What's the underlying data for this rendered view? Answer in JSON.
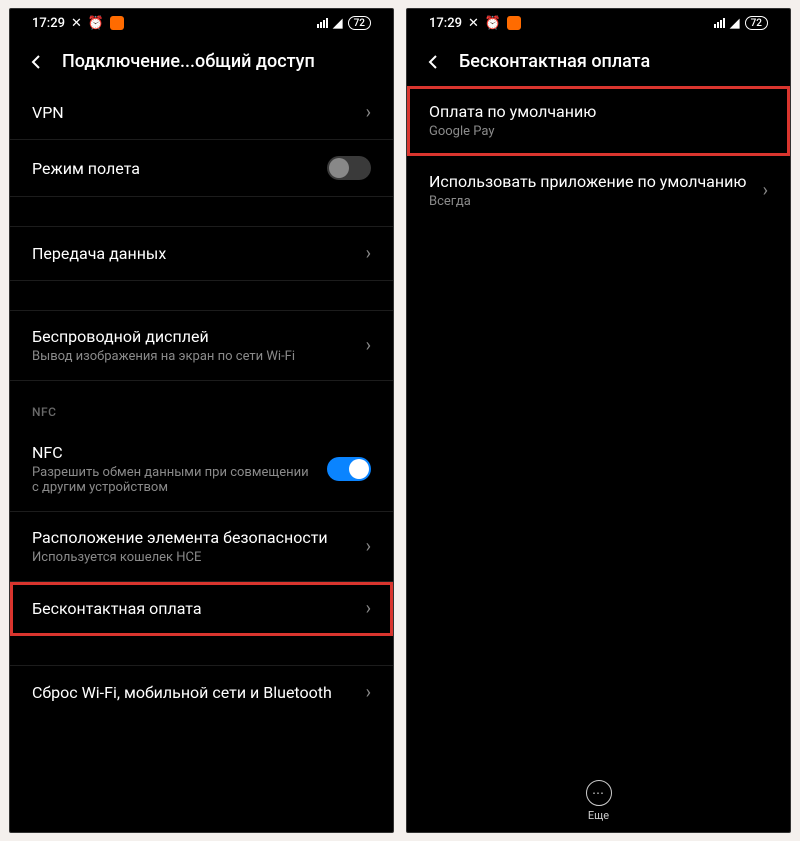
{
  "status": {
    "time": "17:29",
    "battery": "72"
  },
  "left": {
    "title": "Подключение...общий доступ",
    "items": {
      "vpn": "VPN",
      "airplane": "Режим полета",
      "data": "Передача данных",
      "wireless_display": {
        "title": "Беспроводной дисплей",
        "sub": "Вывод изображения на экран по сети Wi-Fi"
      },
      "nfc_section": "NFC",
      "nfc": {
        "title": "NFC",
        "sub": "Разрешить обмен данными при совмещении с другим устройством"
      },
      "secure_element": {
        "title": "Расположение элемента безопасности",
        "sub": "Используется кошелек HCE"
      },
      "contactless": "Бесконтактная оплата",
      "reset": "Сброс Wi-Fi, мобильной сети и Bluetooth"
    }
  },
  "right": {
    "title": "Бесконтактная оплата",
    "items": {
      "default_pay": {
        "title": "Оплата по умолчанию",
        "sub": "Google Pay"
      },
      "use_default_app": {
        "title": "Использовать приложение по умолчанию",
        "sub": "Всегда"
      }
    },
    "more": "Еще"
  }
}
